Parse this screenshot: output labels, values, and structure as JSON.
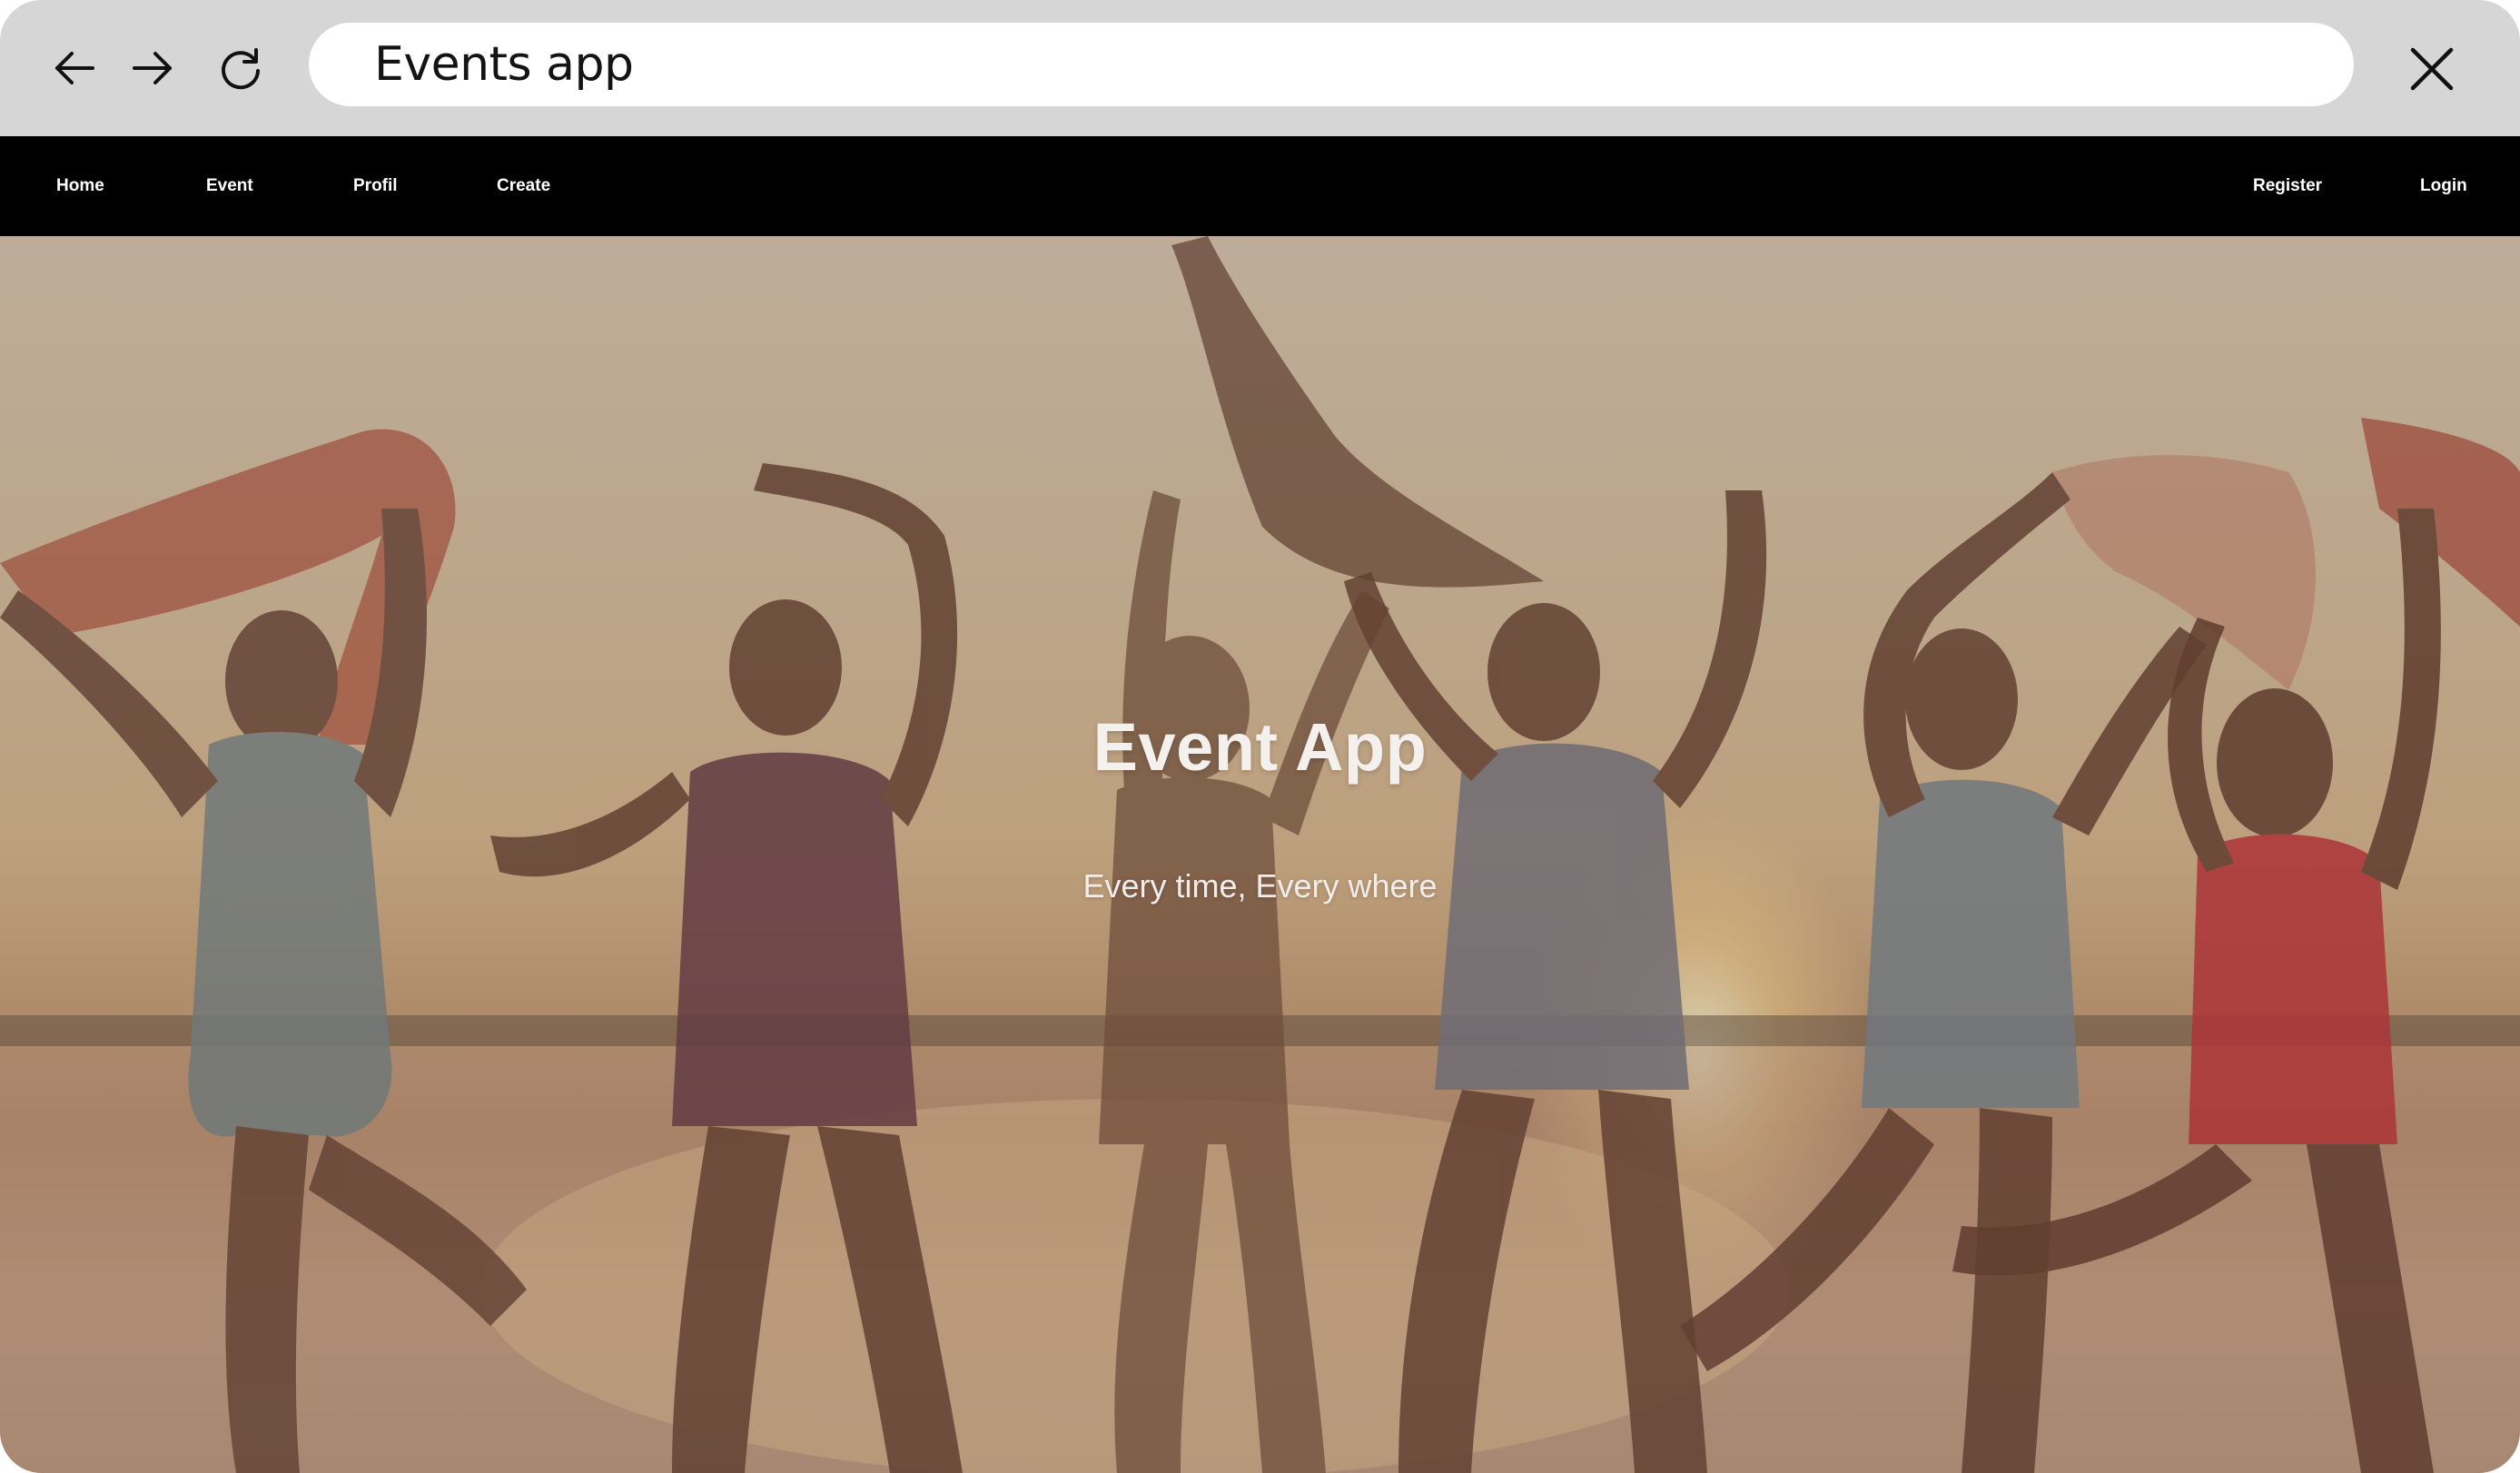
{
  "browser": {
    "address": "Events app",
    "icons": {
      "back": "arrow-left-icon",
      "forward": "arrow-right-icon",
      "reload": "reload-icon",
      "close": "close-icon"
    }
  },
  "navbar": {
    "left_links": [
      "Home",
      "Event",
      "Profil",
      "Create"
    ],
    "right_links": [
      "Register",
      "Login"
    ],
    "background": "#000000",
    "text_color": "#ffffff"
  },
  "hero": {
    "title": "Event App",
    "subtitle": "Every time, Every where"
  },
  "colors": {
    "chrome": "#d6d6d6",
    "address_bar": "#ffffff"
  }
}
